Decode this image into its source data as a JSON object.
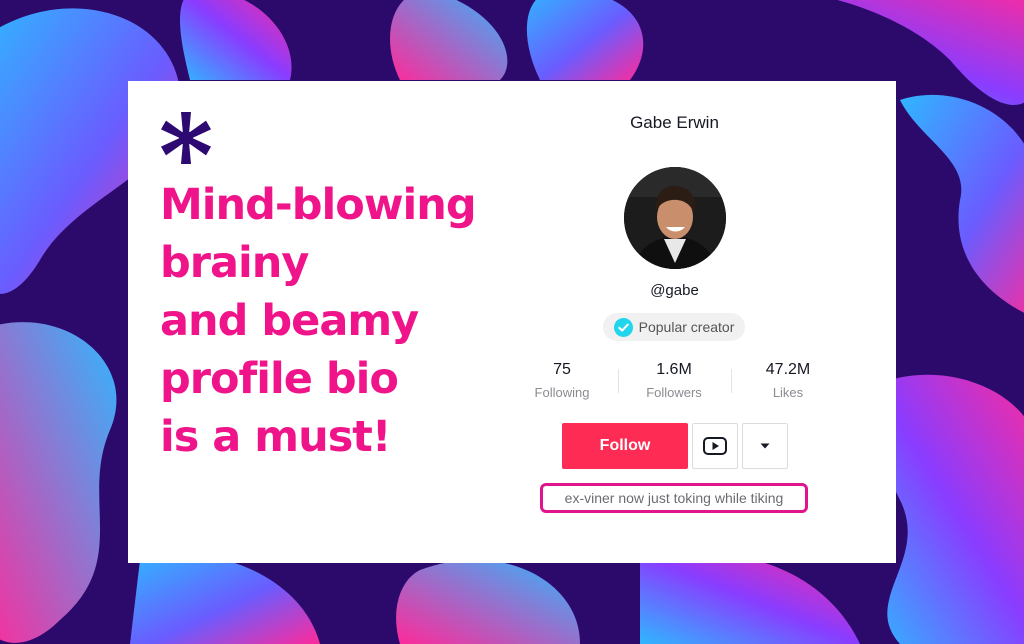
{
  "headline": {
    "lines": [
      "Mind-blowing",
      "brainy",
      "and beamy",
      "profile bio",
      "is a must!"
    ]
  },
  "profile": {
    "display_name": "Gabe Erwin",
    "handle": "@gabe",
    "badge_label": "Popular creator",
    "stats": [
      {
        "value": "75",
        "label": "Following"
      },
      {
        "value": "1.6M",
        "label": "Followers"
      },
      {
        "value": "47.2M",
        "label": "Likes"
      }
    ],
    "follow_label": "Follow",
    "bio": "ex-viner now just toking while tiking"
  },
  "colors": {
    "headline_pink": "#f0148a",
    "follow_red": "#fe2c55",
    "verified_cyan": "#20d5ec",
    "background_purple": "#2c0a6b",
    "logo_purple": "#2d0a72"
  },
  "icons": {
    "logo": "asterisk-icon",
    "badge": "verified-check-icon",
    "video": "youtube-icon",
    "more": "caret-down-icon"
  }
}
